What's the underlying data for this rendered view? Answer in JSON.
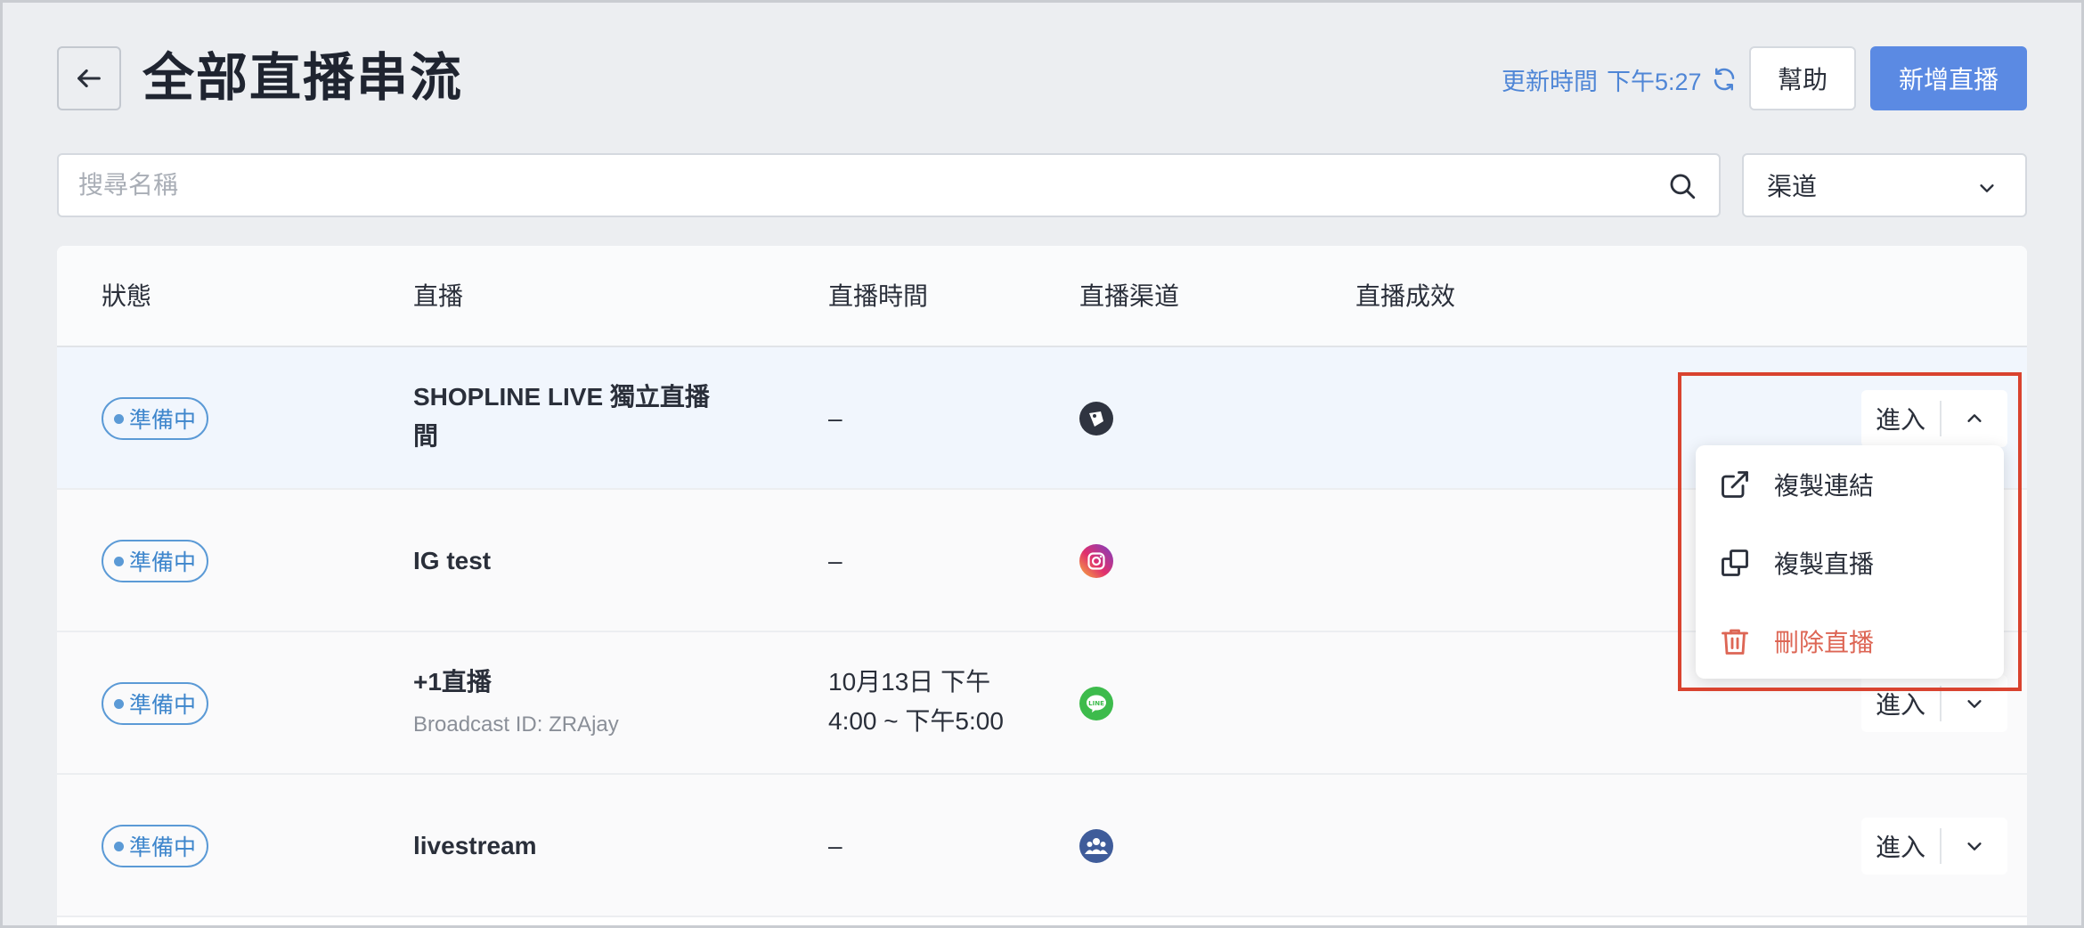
{
  "header": {
    "title": "全部直播串流",
    "update_label": "更新時間",
    "update_time": "下午5:27",
    "help_label": "幫助",
    "add_label": "新增直播"
  },
  "search": {
    "placeholder": "搜尋名稱",
    "channel_placeholder": "渠道"
  },
  "table": {
    "columns": [
      "狀態",
      "直播",
      "直播時間",
      "直播渠道",
      "直播成效"
    ],
    "rows": [
      {
        "status": "準備中",
        "name": "SHOPLINE LIVE 獨立直播間",
        "sub": "",
        "time_line1": "–",
        "time_line2": "",
        "channel": "shopline-icon",
        "enter": "進入"
      },
      {
        "status": "準備中",
        "name": "IG test",
        "sub": "",
        "time_line1": "–",
        "time_line2": "",
        "channel": "instagram-icon",
        "enter": "進入"
      },
      {
        "status": "準備中",
        "name": "+1直播",
        "sub": "Broadcast ID: ZRAjay",
        "time_line1": "10月13日 下午",
        "time_line2": "4:00 ~ 下午5:00",
        "channel": "line-icon",
        "enter": "進入"
      },
      {
        "status": "準備中",
        "name": "livestream",
        "sub": "",
        "time_line1": "–",
        "time_line2": "",
        "channel": "group-icon",
        "enter": "進入"
      }
    ]
  },
  "dropdown": {
    "items": [
      {
        "label": "複製連結",
        "icon": "external-link-icon"
      },
      {
        "label": "複製直播",
        "icon": "copy-icon"
      },
      {
        "label": "刪除直播",
        "icon": "trash-icon"
      }
    ]
  },
  "colors": {
    "primary": "#5b8ae3",
    "link": "#4f86d6",
    "status": "#3e86cc",
    "danger": "#dd6655",
    "highlight": "#d9432f"
  }
}
